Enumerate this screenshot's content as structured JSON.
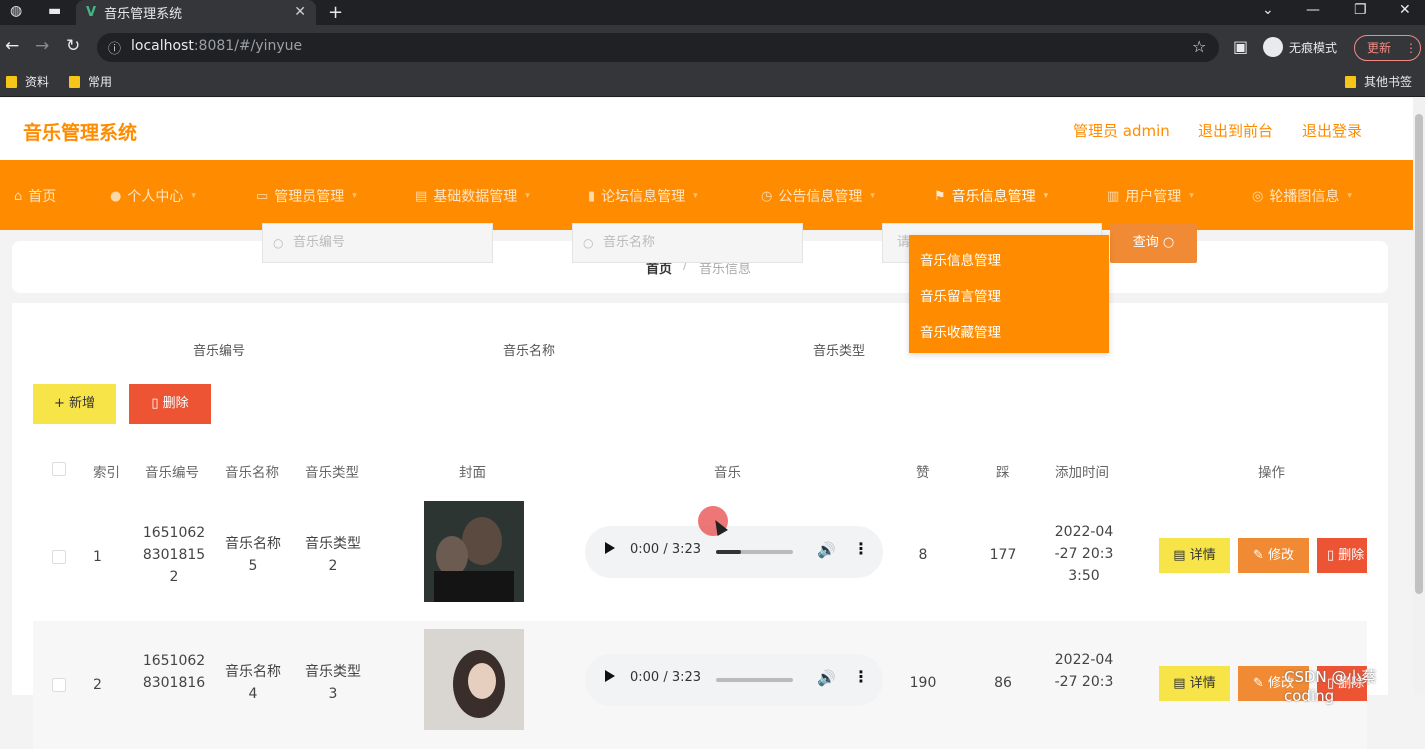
{
  "browser": {
    "tab_title": "音乐管理系统",
    "url_host": "localhost",
    "url_rest": ":8081/#/yinyue",
    "incognito_label": "无痕模式",
    "update_label": "更新",
    "bookmarks": [
      "资料",
      "常用"
    ],
    "other_bookmarks": "其他书签"
  },
  "header": {
    "site_title": "音乐管理系统",
    "admin_label": "管理员 admin",
    "back_front": "退出到前台",
    "logout": "退出登录"
  },
  "nav": {
    "items": [
      {
        "label": "首页",
        "icon": "home-icon"
      },
      {
        "label": "个人中心",
        "icon": "user-icon"
      },
      {
        "label": "管理员管理",
        "icon": "admin-icon"
      },
      {
        "label": "基础数据管理",
        "icon": "data-icon"
      },
      {
        "label": "论坛信息管理",
        "icon": "forum-icon"
      },
      {
        "label": "公告信息管理",
        "icon": "notice-icon"
      },
      {
        "label": "音乐信息管理",
        "icon": "flag-icon"
      },
      {
        "label": "用户管理",
        "icon": "users-icon"
      },
      {
        "label": "轮播图信息",
        "icon": "carousel-icon"
      }
    ],
    "dropdown": [
      "音乐信息管理",
      "音乐留言管理",
      "音乐收藏管理"
    ]
  },
  "breadcrumb": {
    "home": "首页",
    "sep": "/",
    "current": "音乐信息"
  },
  "search": {
    "code_label": "音乐编号",
    "code_placeholder": "音乐编号",
    "name_label": "音乐名称",
    "name_placeholder": "音乐名称",
    "type_label": "音乐类型",
    "type_placeholder": "请",
    "query_label": "查询"
  },
  "actions": {
    "add_label": "+ 新增",
    "delete_label": "删除"
  },
  "table": {
    "headers": [
      "索引",
      "音乐编号",
      "音乐名称",
      "音乐类型",
      "封面",
      "音乐",
      "赞",
      "踩",
      "添加时间",
      "操作"
    ],
    "rows": [
      {
        "index": "1",
        "code": [
          "1651062",
          "8301815",
          "2"
        ],
        "name": [
          "音乐名称",
          "5"
        ],
        "type": [
          "音乐类型",
          "2"
        ],
        "time": "0:00 / 3:23",
        "likes": "8",
        "dislikes": "177",
        "added": [
          "2022-04",
          "-27 20:3",
          "3:50"
        ]
      },
      {
        "index": "2",
        "code": [
          "1651062",
          "8301816",
          ""
        ],
        "name": [
          "音乐名称",
          "4"
        ],
        "type": [
          "音乐类型",
          "3"
        ],
        "time": "0:00 / 3:23",
        "likes": "190",
        "dislikes": "86",
        "added": [
          "2022-04",
          "-27 20:3",
          ""
        ]
      }
    ],
    "btn_detail": "详情",
    "btn_edit": "修改",
    "btn_remove": "删除"
  },
  "watermark": "CSDN @小蔡coding"
}
